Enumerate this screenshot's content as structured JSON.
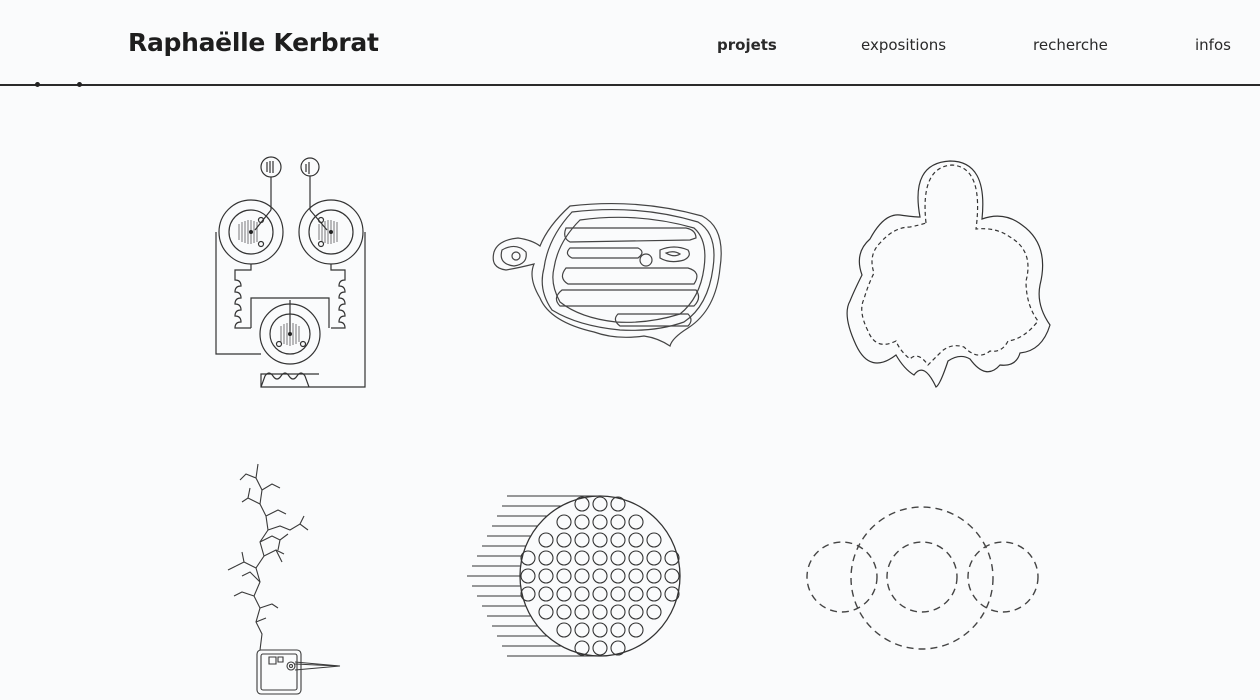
{
  "site": {
    "title": "Raphaëlle Kerbrat"
  },
  "nav": {
    "items": [
      {
        "label": "projets",
        "active": true
      },
      {
        "label": "expositions",
        "active": false
      },
      {
        "label": "recherche",
        "active": false
      },
      {
        "label": "infos",
        "active": false
      }
    ]
  },
  "projects": {
    "tiles": [
      {
        "icon": "circuit-drawing-icon"
      },
      {
        "icon": "contour-blob-drawing-icon"
      },
      {
        "icon": "leaf-outline-drawing-icon"
      },
      {
        "icon": "branching-crack-drawing-icon"
      },
      {
        "icon": "circle-grid-sphere-drawing-icon"
      },
      {
        "icon": "dashed-circles-drawing-icon"
      }
    ]
  }
}
